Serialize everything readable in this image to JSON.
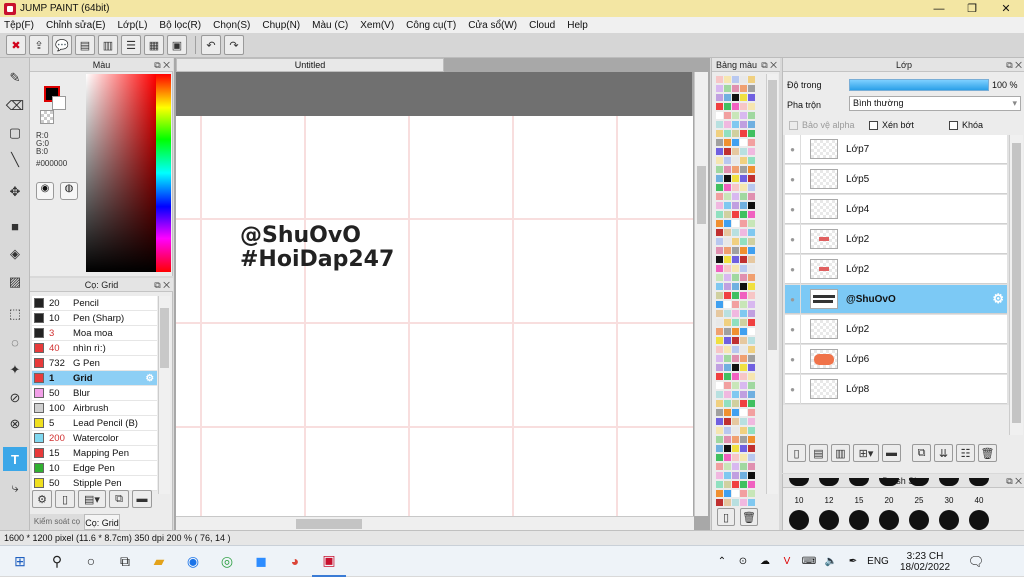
{
  "window": {
    "title": "JUMP PAINT (64bit)",
    "minimize": "—",
    "restore": "❐",
    "close": "✕"
  },
  "menu": [
    "Tệp(F)",
    "Chỉnh sửa(E)",
    "Lớp(L)",
    "Bộ lọc(R)",
    "Chọn(S)",
    "Chụp(N)",
    "Màu (C)",
    "Xem(V)",
    "Công cụ(T)",
    "Cửa sổ(W)",
    "Cloud",
    "Help"
  ],
  "color_panel": {
    "title": "Màu",
    "r": "R:0",
    "g": "G:0",
    "b": "B:0",
    "hex": "#000000"
  },
  "brush_panel": {
    "title": "Cọ: Grid",
    "tab_a": "Kiểm soát cọ",
    "tab_b": "Cọ: Grid",
    "brushes": [
      {
        "size": "20",
        "name": "Pencil",
        "color": "#222222"
      },
      {
        "size": "10",
        "name": "Pen (Sharp)",
        "color": "#222222"
      },
      {
        "size": "3",
        "name": "Moa moa",
        "color": "#222222",
        "size_color": "#d03030"
      },
      {
        "size": "40",
        "name": "nhìn rì:)",
        "color": "#e83a3a",
        "size_color": "#d03030"
      },
      {
        "size": "732",
        "name": "G Pen",
        "color": "#e83a3a"
      },
      {
        "size": "1",
        "name": "Grid",
        "color": "#e83a3a",
        "selected": true
      },
      {
        "size": "50",
        "name": "Blur",
        "color": "#f2a0e8"
      },
      {
        "size": "100",
        "name": "Airbrush",
        "color": "#d0d0d0"
      },
      {
        "size": "5",
        "name": "Lead Pencil (B)",
        "color": "#f0e020"
      },
      {
        "size": "200",
        "name": "Watercolor",
        "color": "#80d8f0",
        "size_color": "#d03030"
      },
      {
        "size": "15",
        "name": "Mapping Pen",
        "color": "#e83a3a"
      },
      {
        "size": "10",
        "name": "Edge Pen",
        "color": "#30b030"
      },
      {
        "size": "50",
        "name": "Stipple Pen",
        "color": "#f0e020"
      }
    ]
  },
  "canvas": {
    "tab": "Untitled",
    "line1": "@ShuOvO",
    "line2": "#HoiDap247"
  },
  "palette_panel": {
    "title": "Bảng màu"
  },
  "layer_panel": {
    "title": "Lớp",
    "opacity_label": "Độ trong",
    "opacity_value": "100 %",
    "opacity": 1.0,
    "blend_label": "Pha trộn",
    "blend_value": "Bình thường",
    "protect_alpha": "Bảo vệ alpha",
    "clipping": "Xén bớt",
    "lock": "Khóa",
    "layers": [
      {
        "name": "Lớp7"
      },
      {
        "name": "Lớp5"
      },
      {
        "name": "Lớp4"
      },
      {
        "name": "Lớp2"
      },
      {
        "name": "Lớp2"
      },
      {
        "name": "@ShuOvO",
        "selected": true
      },
      {
        "name": "Lớp2"
      },
      {
        "name": "Lớp6"
      },
      {
        "name": "Lớp8"
      }
    ]
  },
  "brush_size": {
    "title": "Brush Size",
    "sizes": [
      "10",
      "12",
      "15",
      "20",
      "25",
      "30",
      "40"
    ]
  },
  "status": {
    "text": "1600 * 1200 pixel  (11.6 * 8.7cm)  350 dpi  200 %  ( 76, 14 )"
  },
  "taskbar": {
    "lang": "ENG",
    "time": "3:23 CH",
    "date": "18/02/2022"
  }
}
